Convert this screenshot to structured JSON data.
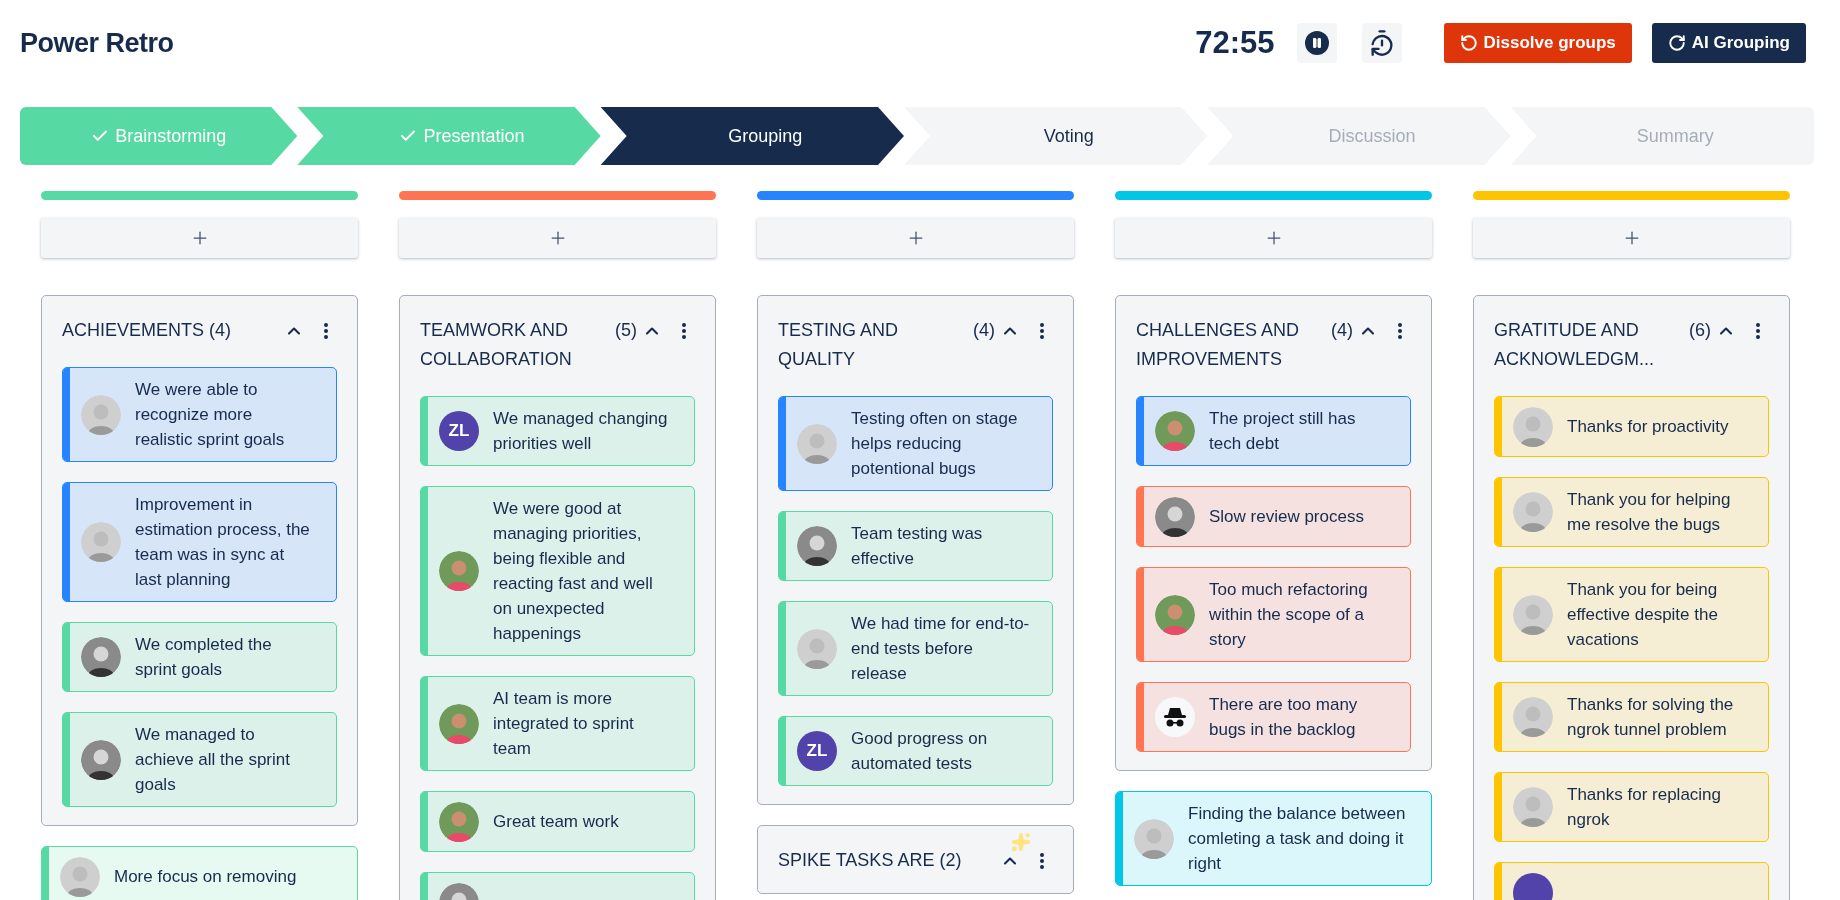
{
  "app": {
    "title": "Power Retro"
  },
  "timer": {
    "time": "72:55",
    "running": true
  },
  "actions": [
    {
      "label": "Dissolve groups",
      "kind": "dissolve"
    },
    {
      "label": "AI Grouping",
      "kind": "ai"
    }
  ],
  "steps": [
    {
      "label": "Brainstorming",
      "completed": true,
      "selected": false,
      "disabled": false
    },
    {
      "label": "Presentation",
      "completed": true,
      "selected": false,
      "disabled": false
    },
    {
      "label": "Grouping",
      "completed": false,
      "selected": true,
      "disabled": false
    },
    {
      "label": "Voting",
      "completed": false,
      "selected": false,
      "disabled": false
    },
    {
      "label": "Discussion",
      "completed": false,
      "selected": false,
      "disabled": true
    },
    {
      "label": "Summary",
      "completed": false,
      "selected": false,
      "disabled": true
    }
  ],
  "columns": [
    {
      "color": "#57d9a3",
      "items": [
        {
          "kind": "group",
          "title": "ACHIEVEMENTS",
          "count": "(4)",
          "expanded": true,
          "ai_suggested": false,
          "cards": [
            {
              "text": "We were able to recognize more realistic sprint goals",
              "color": "#2684ff"
            },
            {
              "text": "Improvement in estimation process, the team was in sync at last planning",
              "color": "#2684ff"
            },
            {
              "text": "We completed the sprint goals",
              "color": "#57d9a3"
            },
            {
              "text": "We managed to achieve all the sprint goals",
              "color": "#57d9a3"
            }
          ]
        },
        {
          "kind": "card",
          "text": "More focus on removing",
          "color": "#57d9a3"
        }
      ]
    },
    {
      "color": "#ff7452",
      "items": [
        {
          "kind": "group",
          "title": "TEAMWORK AND COLLABORATION",
          "count": "(5)",
          "expanded": true,
          "ai_suggested": false,
          "cards": [
            {
              "text": "We managed changing priorities well",
              "color": "#57d9a3",
              "avatar": {
                "kind": "initials",
                "text": "ZL"
              }
            },
            {
              "text": "We were good at managing priorities, being flexible and reacting fast and well on unexpected happenings",
              "color": "#57d9a3"
            },
            {
              "text": "AI team is more integrated to sprint team",
              "color": "#57d9a3"
            },
            {
              "text": "Great team work",
              "color": "#57d9a3"
            },
            {
              "color": "#57d9a3"
            }
          ]
        }
      ]
    },
    {
      "color": "#2684ff",
      "items": [
        {
          "kind": "group",
          "title": "TESTING AND QUALITY",
          "count": "(4)",
          "expanded": true,
          "ai_suggested": false,
          "cards": [
            {
              "text": "Testing often on stage helps reducing potentional bugs",
              "color": "#2684ff"
            },
            {
              "text": "Team testing was effective",
              "color": "#57d9a3"
            },
            {
              "text": "We had time for end-to-end tests before release",
              "color": "#57d9a3"
            },
            {
              "text": "Good progress on automated tests",
              "color": "#57d9a3",
              "avatar": {
                "kind": "initials",
                "text": "ZL"
              }
            }
          ]
        },
        {
          "kind": "group",
          "title": "SPIKE TASKS ARE",
          "count": "(2)",
          "expanded": true,
          "ai_suggested": true
        }
      ]
    },
    {
      "color": "#00c7e6",
      "items": [
        {
          "kind": "group",
          "title": "CHALLENGES AND IMPROVEMENTS",
          "count": "(4)",
          "expanded": true,
          "ai_suggested": false,
          "cards": [
            {
              "text": "The project still has tech debt",
              "color": "#2684ff"
            },
            {
              "text": "Slow review process",
              "color": "#ff7452"
            },
            {
              "text": "Too much refactoring within the scope of a story",
              "color": "#ff7452"
            },
            {
              "text": "There are too many bugs in the backlog",
              "color": "#ff7452",
              "avatar": {
                "kind": "incognito"
              }
            }
          ]
        },
        {
          "kind": "card",
          "text": "Finding the balance between comleting a task and doing it right",
          "color": "#00c7e6"
        }
      ]
    },
    {
      "color": "#ffc400",
      "items": [
        {
          "kind": "group",
          "title": "GRATITUDE AND ACKNOWLEDGM...",
          "count": "(6)",
          "expanded": true,
          "ai_suggested": false,
          "cards": [
            {
              "text": "Thanks for proactivity",
              "color": "#ffc400"
            },
            {
              "text": "Thank you for helping me resolve the bugs",
              "color": "#ffc400"
            },
            {
              "text": "Thank you for being effective despite the vacations",
              "color": "#ffc400"
            },
            {
              "text": "Thanks for solving the ngrok tunnel problem",
              "color": "#ffc400"
            },
            {
              "text": "Thanks for replacing ngrok",
              "color": "#ffc400"
            },
            {
              "color": "#ffc400",
              "avatar": {
                "kind": "initials"
              }
            }
          ]
        }
      ]
    }
  ]
}
